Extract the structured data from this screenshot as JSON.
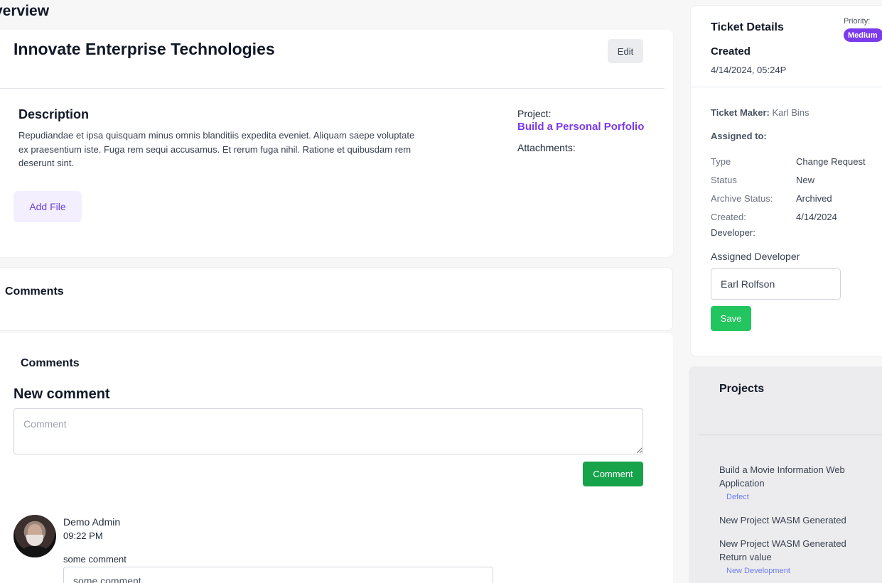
{
  "page": {
    "title": "verview"
  },
  "ticket": {
    "title": "Innovate Enterprise Technologies",
    "edit_label": "Edit",
    "description_heading": "Description",
    "description": "Repudiandae et ipsa quisquam minus omnis blanditiis expedita eveniet. Aliquam saepe voluptate ex praesentium iste. Fuga rem sequi accusamus. Et rerum fuga nihil. Ratione et quibusdam rem deserunt sint.",
    "project_label": "Project:",
    "project_name": "Build a Personal Porfolio",
    "attachments_label": "Attachments:",
    "add_file_label": "Add File"
  },
  "comments": {
    "section_title": "Comments",
    "subtitle": "Comments",
    "new_comment_title": "New comment",
    "placeholder": "Comment",
    "submit_label": "Comment",
    "items": [
      {
        "author": "Demo Admin",
        "time": "09:22 PM",
        "label": "some comment",
        "value": "some comment"
      }
    ]
  },
  "details": {
    "title": "Ticket Details",
    "priority_label": "Priority:",
    "priority": "Medium",
    "created_heading": "Created",
    "created_at": "4/14/2024, 05:24P",
    "maker_label": "Ticket Maker:",
    "maker": "Karl Bins",
    "assigned_label": "Assigned to:",
    "fields": [
      {
        "key": "Type",
        "value": "Change Request"
      },
      {
        "key": "Status",
        "value": "New"
      },
      {
        "key": "Archive Status:",
        "value": "Archived"
      },
      {
        "key": "Created:",
        "value": "4/14/2024"
      }
    ],
    "developer_label": "Developer:",
    "assigned_developer_label": "Assigned Developer",
    "assigned_developer": "Earl Rolfson",
    "save_label": "Save"
  },
  "projects": {
    "title": "Projects",
    "items": [
      {
        "name": "Build a Movie Information Web Application",
        "tag": "Defect"
      },
      {
        "name": "New Project WASM Generated",
        "tag": ""
      },
      {
        "name": "New Project WASM Generated Return value",
        "tag": "New Development"
      }
    ]
  },
  "colors": {
    "accent": "#7c3aed",
    "success": "#16a34a",
    "save": "#22c55e",
    "tag": "#6d7cf0"
  }
}
